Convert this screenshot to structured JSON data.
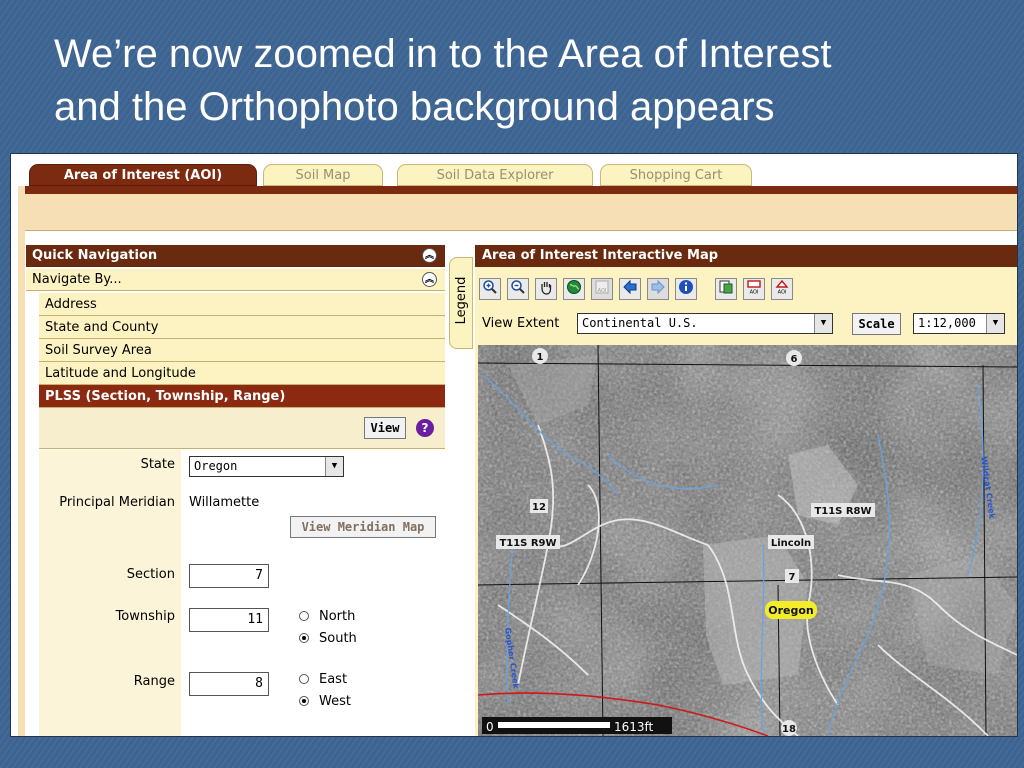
{
  "slide": {
    "title_line1": "We’re now zoomed in to the Area of Interest",
    "title_line2": "and the Orthophoto background appears"
  },
  "tabs": [
    {
      "label": "Area of Interest (AOI)",
      "active": true
    },
    {
      "label": "Soil Map",
      "active": false
    },
    {
      "label": "Soil Data Explorer",
      "active": false
    },
    {
      "label": "Shopping Cart",
      "active": false
    }
  ],
  "quick_nav": {
    "header": "Quick Navigation",
    "navigate_by": "Navigate By...",
    "items": [
      {
        "label": "Address"
      },
      {
        "label": "State and County"
      },
      {
        "label": "Soil Survey Area"
      },
      {
        "label": "Latitude and Longitude"
      },
      {
        "label": "PLSS (Section, Township, Range)"
      }
    ],
    "view_button": "View",
    "help_icon": "?"
  },
  "plss_form": {
    "state_label": "State",
    "state_value": "Oregon",
    "meridian_label": "Principal Meridian",
    "meridian_value": "Willamette",
    "meridian_map_button": "View Meridian Map",
    "section_label": "Section",
    "section_value": "7",
    "township_label": "Township",
    "township_value": "11",
    "township_options": [
      "North",
      "South"
    ],
    "township_selected": "South",
    "range_label": "Range",
    "range_value": "8",
    "range_options": [
      "East",
      "West"
    ],
    "range_selected": "West"
  },
  "legend_tab": "Legend",
  "map": {
    "header": "Area of Interest Interactive Map",
    "tool_icons": [
      "zoom-in-icon",
      "zoom-out-icon",
      "pan-hand-icon",
      "full-extent-globe-icon",
      "aoi-disabled-icon",
      "back-arrow-icon",
      "forward-arrow-icon",
      "identify-info-icon",
      "select-features-icon",
      "define-aoi-rectangle-icon",
      "define-aoi-polygon-icon"
    ],
    "view_extent_label": "View Extent",
    "view_extent_value": "Continental U.S.",
    "scale_button": "Scale",
    "scale_value": "1:12,000",
    "labels": {
      "section_1": "1",
      "section_6": "6",
      "section_12": "12",
      "section_7": "7",
      "section_18": "18",
      "township_east": "T11S R8W",
      "township_west": "T11S R9W",
      "county": "Lincoln",
      "state": "Oregon",
      "creek_east": "Wildcat Creek",
      "creek_west": "Gopher Creek"
    },
    "scalebar_start": "0",
    "scalebar_end": "1613ft"
  },
  "colors": {
    "slide_bg": "#3f6695",
    "header_brown": "#6a2a10",
    "active_tab": "#7c2a10",
    "cream": "#fdf3c2",
    "selected_item": "#8b2a10",
    "help_purple": "#6b1fa0",
    "map_highlight": "#f2ec2a"
  }
}
